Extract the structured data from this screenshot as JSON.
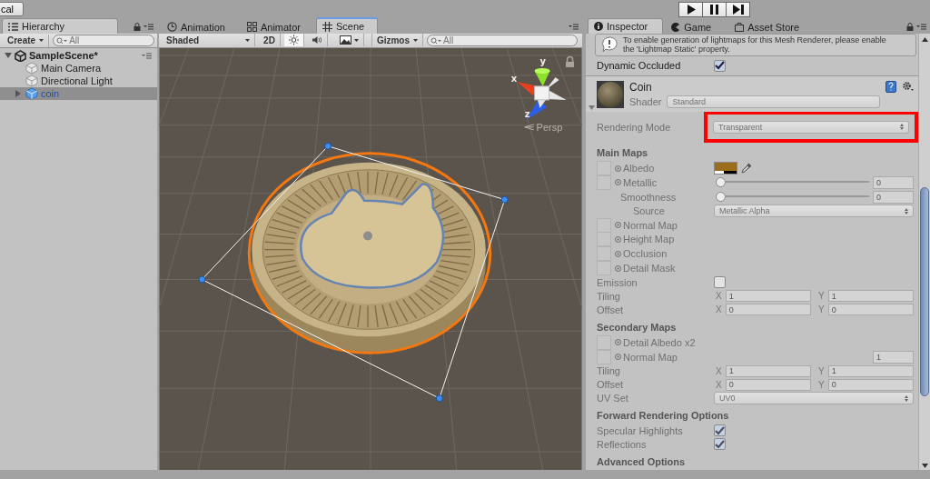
{
  "toolbar": {
    "left_button": "cal",
    "play_controls": [
      {
        "kind": "play",
        "selected": false
      },
      {
        "kind": "pause",
        "selected": false
      },
      {
        "kind": "step",
        "selected": false
      }
    ]
  },
  "hierarchy": {
    "tab": {
      "label": "Hierarchy",
      "selected": true
    },
    "create": "Create",
    "search": {
      "placeholder": "All"
    },
    "scene": {
      "name": "SampleScene*",
      "expanded": true,
      "children": [
        {
          "name": "Main Camera",
          "kind": "object",
          "expandable": false,
          "selected": false
        },
        {
          "name": "Directional Light",
          "kind": "object",
          "expandable": false,
          "selected": false
        },
        {
          "name": "coin",
          "kind": "prefab",
          "expandable": true,
          "expanded": false,
          "selected": true
        }
      ]
    }
  },
  "scene_panel": {
    "tabs": [
      {
        "label": "Animation",
        "kind": "clock",
        "selected": false
      },
      {
        "label": "Animator",
        "kind": "animator",
        "selected": false
      },
      {
        "label": "Scene",
        "kind": "grid",
        "selected": true
      }
    ],
    "shading": "Shaded",
    "mode_2d": {
      "label": "2D",
      "selected": false
    },
    "lighting": {
      "selected": true
    },
    "audio": {
      "selected": false
    },
    "gizmos": "Gizmos",
    "search": {
      "placeholder": "All"
    },
    "gizmo": {
      "axes": [
        "y",
        "x",
        "z"
      ],
      "projection": "Persp"
    }
  },
  "inspector": {
    "tabs": [
      {
        "label": "Inspector",
        "kind": "info",
        "selected": true
      },
      {
        "label": "Game",
        "kind": "game",
        "selected": false
      },
      {
        "label": "Asset Store",
        "kind": "store",
        "selected": false
      }
    ],
    "help_lines": [
      "To enable generation of lightmaps for this Mesh Renderer, please enable",
      "the 'Lightmap Static' property."
    ],
    "dynamic_occluded": {
      "label": "Dynamic Occluded",
      "checked": true
    },
    "material": {
      "name": "Coin",
      "shader_label": "Shader",
      "shader": "Standard",
      "disabled": true
    },
    "rendering_mode": {
      "label": "Rendering Mode",
      "value": "Transparent",
      "highlighted": true
    },
    "rows": [
      {
        "kind": "header",
        "label": "Main Maps"
      },
      {
        "kind": "texture",
        "label": "Albedo",
        "color": "#9a6e1c"
      },
      {
        "kind": "texture_slider",
        "label": "Metallic",
        "level": 0,
        "value": "0"
      },
      {
        "kind": "slider",
        "label": "Smoothness",
        "level": 0,
        "value": "0"
      },
      {
        "kind": "sub_dropdown",
        "label": "Source",
        "value": "Metallic Alpha"
      },
      {
        "kind": "texture",
        "label": "Normal Map"
      },
      {
        "kind": "texture",
        "label": "Height Map"
      },
      {
        "kind": "texture",
        "label": "Occlusion"
      },
      {
        "kind": "texture",
        "label": "Detail Mask"
      },
      {
        "kind": "checkbox",
        "label": "Emission",
        "checked": false
      },
      {
        "kind": "vector",
        "label": "Tiling",
        "x": {
          "label": "X",
          "value": "1"
        },
        "y": {
          "label": "Y",
          "value": "1"
        }
      },
      {
        "kind": "vector",
        "label": "Offset",
        "x": {
          "label": "X",
          "value": "0"
        },
        "y": {
          "label": "Y",
          "value": "0"
        }
      },
      {
        "kind": "header",
        "label": "Secondary Maps"
      },
      {
        "kind": "texture",
        "label": "Detail Albedo x2"
      },
      {
        "kind": "texture_value",
        "label": "Normal Map",
        "value": "1"
      },
      {
        "kind": "vector",
        "label": "Tiling",
        "x": {
          "label": "X",
          "value": "1"
        },
        "y": {
          "label": "Y",
          "value": "1"
        }
      },
      {
        "kind": "vector",
        "label": "Offset",
        "x": {
          "label": "X",
          "value": "0"
        },
        "y": {
          "label": "Y",
          "value": "0"
        }
      },
      {
        "kind": "dropdown",
        "label": "UV Set",
        "value": "UV0"
      },
      {
        "kind": "header",
        "label": "Forward Rendering Options"
      },
      {
        "kind": "checkbox",
        "label": "Specular Highlights",
        "checked": true
      },
      {
        "kind": "checkbox",
        "label": "Reflections",
        "checked": true
      },
      {
        "kind": "header",
        "label": "Advanced Options"
      }
    ]
  }
}
